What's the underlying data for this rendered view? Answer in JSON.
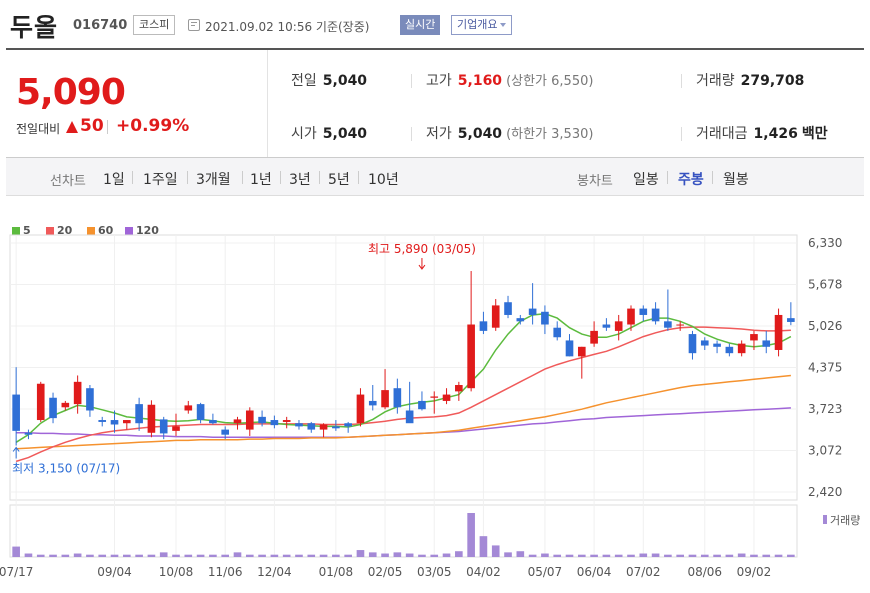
{
  "header": {
    "name": "두올",
    "code": "016740",
    "market": "코스피",
    "timestamp": "2021.09.02 10:56 기준(장중)",
    "realtime_label": "실시간",
    "company_label": "기업개요"
  },
  "quote": {
    "price": "5,090",
    "change_label": "전일대비",
    "change": "50",
    "change_pct": "+0.99%",
    "prev_close_label": "전일",
    "prev_close": "5,040",
    "high_label": "고가",
    "high": "5,160",
    "upper_limit": "(상한가 6,550)",
    "volume_label": "거래량",
    "volume": "279,708",
    "open_label": "시가",
    "open": "5,040",
    "low_label": "저가",
    "low": "5,040",
    "lower_limit": "(하한가 3,530)",
    "amount_label": "거래대금",
    "amount": "1,426",
    "amount_unit": "백만"
  },
  "tabs": {
    "line_label": "선차트",
    "line_items": [
      "1일",
      "1주일",
      "3개월",
      "1년",
      "3년",
      "5년",
      "10년"
    ],
    "candle_label": "봉차트",
    "candle_items": [
      "일봉",
      "주봉",
      "월봉"
    ],
    "candle_selected": 1
  },
  "colors": {
    "up": "#e01b1b",
    "down": "#2f6fd6",
    "ma5": "#5cbb3e",
    "ma20": "#f05a5a",
    "ma60": "#f5922e",
    "ma120": "#a065d8",
    "volume": "#a489d6"
  },
  "chart_data": {
    "type": "candlestick",
    "legend": [
      "5",
      "20",
      "60",
      "120"
    ],
    "y_ticks": [
      "6,330",
      "5,678",
      "5,026",
      "4,375",
      "3,723",
      "3,072",
      "2,420"
    ],
    "y_values": [
      6330,
      5678,
      5026,
      4375,
      3723,
      3072,
      2420
    ],
    "ylim": [
      2420,
      6330
    ],
    "x_ticks": [
      "07/17",
      "09/04",
      "10/08",
      "11/06",
      "12/04",
      "01/08",
      "02/05",
      "03/05",
      "04/02",
      "05/07",
      "06/04",
      "07/02",
      "08/06",
      "09/02"
    ],
    "x_tick_index": [
      0,
      8,
      13,
      17,
      21,
      26,
      30,
      34,
      38,
      43,
      47,
      51,
      56,
      60
    ],
    "max_annotation": "최고 5,890 (03/05)",
    "max_index": 33,
    "max_value": 5890,
    "min_annotation": "최저 3,150 (07/17)",
    "min_index": 0,
    "min_value": 3150,
    "volume_label": "거래량",
    "candles": [
      {
        "o": 3950,
        "h": 4380,
        "l": 3150,
        "c": 3380
      },
      {
        "o": 3350,
        "h": 3400,
        "l": 3250,
        "c": 3320
      },
      {
        "o": 3550,
        "h": 4150,
        "l": 3520,
        "c": 4120
      },
      {
        "o": 3900,
        "h": 3980,
        "l": 3500,
        "c": 3580
      },
      {
        "o": 3750,
        "h": 3850,
        "l": 3700,
        "c": 3820
      },
      {
        "o": 3800,
        "h": 4250,
        "l": 3650,
        "c": 4150
      },
      {
        "o": 4050,
        "h": 4100,
        "l": 3600,
        "c": 3700
      },
      {
        "o": 3550,
        "h": 3600,
        "l": 3450,
        "c": 3520
      },
      {
        "o": 3550,
        "h": 3700,
        "l": 3350,
        "c": 3480
      },
      {
        "o": 3500,
        "h": 3550,
        "l": 3400,
        "c": 3550
      },
      {
        "o": 3800,
        "h": 3900,
        "l": 3380,
        "c": 3500
      },
      {
        "o": 3350,
        "h": 3860,
        "l": 3280,
        "c": 3790
      },
      {
        "o": 3560,
        "h": 3600,
        "l": 3250,
        "c": 3340
      },
      {
        "o": 3380,
        "h": 3650,
        "l": 3300,
        "c": 3450
      },
      {
        "o": 3700,
        "h": 3850,
        "l": 3650,
        "c": 3780
      },
      {
        "o": 3800,
        "h": 3820,
        "l": 3500,
        "c": 3550
      },
      {
        "o": 3550,
        "h": 3650,
        "l": 3480,
        "c": 3500
      },
      {
        "o": 3400,
        "h": 3450,
        "l": 3250,
        "c": 3320
      },
      {
        "o": 3500,
        "h": 3600,
        "l": 3400,
        "c": 3560
      },
      {
        "o": 3400,
        "h": 3750,
        "l": 3300,
        "c": 3700
      },
      {
        "o": 3600,
        "h": 3700,
        "l": 3450,
        "c": 3500
      },
      {
        "o": 3550,
        "h": 3620,
        "l": 3420,
        "c": 3470
      },
      {
        "o": 3520,
        "h": 3600,
        "l": 3420,
        "c": 3550
      },
      {
        "o": 3500,
        "h": 3550,
        "l": 3400,
        "c": 3450
      },
      {
        "o": 3500,
        "h": 3520,
        "l": 3350,
        "c": 3400
      },
      {
        "o": 3400,
        "h": 3500,
        "l": 3280,
        "c": 3480
      },
      {
        "o": 3450,
        "h": 3550,
        "l": 3380,
        "c": 3420
      },
      {
        "o": 3500,
        "h": 3520,
        "l": 3350,
        "c": 3450
      },
      {
        "o": 3500,
        "h": 4050,
        "l": 3450,
        "c": 3950
      },
      {
        "o": 3850,
        "h": 4100,
        "l": 3700,
        "c": 3780
      },
      {
        "o": 3750,
        "h": 4350,
        "l": 3720,
        "c": 4020
      },
      {
        "o": 4050,
        "h": 4200,
        "l": 3650,
        "c": 3750
      },
      {
        "o": 3700,
        "h": 4150,
        "l": 3550,
        "c": 3500
      },
      {
        "o": 3850,
        "h": 4000,
        "l": 3700,
        "c": 3720
      },
      {
        "o": 3900,
        "h": 4000,
        "l": 3650,
        "c": 3920
      },
      {
        "o": 3850,
        "h": 4050,
        "l": 3800,
        "c": 3950
      },
      {
        "o": 4000,
        "h": 4150,
        "l": 3850,
        "c": 4100
      },
      {
        "o": 4050,
        "h": 5890,
        "l": 4000,
        "c": 5050
      },
      {
        "o": 5100,
        "h": 5250,
        "l": 4900,
        "c": 4950
      },
      {
        "o": 5000,
        "h": 5450,
        "l": 4950,
        "c": 5350
      },
      {
        "o": 5400,
        "h": 5500,
        "l": 5150,
        "c": 5200
      },
      {
        "o": 5150,
        "h": 5200,
        "l": 5050,
        "c": 5100
      },
      {
        "o": 5300,
        "h": 5700,
        "l": 5050,
        "c": 5200
      },
      {
        "o": 5250,
        "h": 5350,
        "l": 4900,
        "c": 5050
      },
      {
        "o": 5000,
        "h": 5100,
        "l": 4800,
        "c": 4850
      },
      {
        "o": 4800,
        "h": 4900,
        "l": 4550,
        "c": 4550
      },
      {
        "o": 4550,
        "h": 4700,
        "l": 4200,
        "c": 4700
      },
      {
        "o": 4750,
        "h": 5100,
        "l": 4700,
        "c": 4950
      },
      {
        "o": 5050,
        "h": 5150,
        "l": 4950,
        "c": 5000
      },
      {
        "o": 4950,
        "h": 5200,
        "l": 4800,
        "c": 5100
      },
      {
        "o": 5050,
        "h": 5350,
        "l": 4950,
        "c": 5300
      },
      {
        "o": 5300,
        "h": 5350,
        "l": 5100,
        "c": 5200
      },
      {
        "o": 5300,
        "h": 5400,
        "l": 5050,
        "c": 5100
      },
      {
        "o": 5100,
        "h": 5600,
        "l": 4950,
        "c": 5000
      },
      {
        "o": 5050,
        "h": 5100,
        "l": 4950,
        "c": 5050
      },
      {
        "o": 4900,
        "h": 4950,
        "l": 4500,
        "c": 4600
      },
      {
        "o": 4800,
        "h": 4850,
        "l": 4650,
        "c": 4720
      },
      {
        "o": 4750,
        "h": 4800,
        "l": 4600,
        "c": 4700
      },
      {
        "o": 4700,
        "h": 4750,
        "l": 4550,
        "c": 4600
      },
      {
        "o": 4600,
        "h": 4800,
        "l": 4550,
        "c": 4750
      },
      {
        "o": 4800,
        "h": 4950,
        "l": 4650,
        "c": 4900
      },
      {
        "o": 4800,
        "h": 4950,
        "l": 4600,
        "c": 4700
      },
      {
        "o": 4650,
        "h": 5300,
        "l": 4550,
        "c": 5200
      },
      {
        "o": 5150,
        "h": 5400,
        "l": 5040,
        "c": 5090
      }
    ],
    "volume": [
      9,
      3,
      2,
      2,
      2,
      3,
      2,
      2,
      2,
      2,
      2,
      2,
      4,
      2,
      2,
      2,
      2,
      2,
      4,
      2,
      2,
      2,
      2,
      2,
      2,
      2,
      2,
      2,
      6,
      4,
      3,
      4,
      3,
      2,
      2,
      3,
      5,
      38,
      18,
      10,
      4,
      5,
      2,
      3,
      2,
      2,
      2,
      2,
      2,
      2,
      2,
      3,
      3,
      2,
      2,
      2,
      2,
      2,
      2,
      3,
      2,
      2,
      2,
      2
    ],
    "ma5": [
      3200,
      3320,
      3500,
      3620,
      3700,
      3780,
      3760,
      3710,
      3660,
      3600,
      3580,
      3560,
      3540,
      3530,
      3540,
      3560,
      3540,
      3510,
      3500,
      3510,
      3520,
      3500,
      3480,
      3470,
      3460,
      3450,
      3450,
      3440,
      3480,
      3560,
      3680,
      3760,
      3800,
      3830,
      3850,
      3900,
      3950,
      4150,
      4350,
      4650,
      4900,
      5100,
      5200,
      5220,
      5150,
      5000,
      4900,
      4850,
      4850,
      4900,
      5000,
      5100,
      5150,
      5150,
      5100,
      5020,
      4900,
      4820,
      4760,
      4720,
      4700,
      4720,
      4760,
      4860
    ],
    "ma20": [
      2900,
      2960,
      3050,
      3130,
      3200,
      3260,
      3310,
      3350,
      3380,
      3400,
      3420,
      3440,
      3450,
      3460,
      3470,
      3480,
      3480,
      3480,
      3480,
      3490,
      3490,
      3490,
      3490,
      3490,
      3490,
      3480,
      3480,
      3480,
      3490,
      3510,
      3530,
      3560,
      3580,
      3590,
      3600,
      3620,
      3660,
      3750,
      3850,
      3950,
      4050,
      4150,
      4250,
      4350,
      4420,
      4480,
      4530,
      4580,
      4630,
      4700,
      4780,
      4860,
      4920,
      4970,
      5000,
      5010,
      5010,
      5000,
      4990,
      4980,
      4960,
      4950,
      4950,
      4960
    ],
    "ma60": [
      3100,
      3110,
      3120,
      3130,
      3140,
      3150,
      3160,
      3170,
      3180,
      3190,
      3200,
      3210,
      3220,
      3230,
      3230,
      3240,
      3240,
      3240,
      3240,
      3250,
      3250,
      3260,
      3260,
      3260,
      3270,
      3270,
      3270,
      3280,
      3290,
      3300,
      3310,
      3320,
      3330,
      3340,
      3350,
      3370,
      3390,
      3420,
      3450,
      3480,
      3510,
      3540,
      3570,
      3600,
      3640,
      3680,
      3720,
      3770,
      3820,
      3860,
      3900,
      3940,
      3980,
      4020,
      4060,
      4090,
      4110,
      4130,
      4150,
      4170,
      4190,
      4210,
      4230,
      4250
    ],
    "ma120": [
      3350,
      3350,
      3340,
      3340,
      3330,
      3330,
      3320,
      3320,
      3310,
      3310,
      3300,
      3300,
      3300,
      3290,
      3290,
      3290,
      3280,
      3280,
      3280,
      3280,
      3280,
      3280,
      3280,
      3280,
      3280,
      3280,
      3280,
      3280,
      3290,
      3300,
      3310,
      3320,
      3330,
      3340,
      3350,
      3360,
      3370,
      3390,
      3410,
      3430,
      3450,
      3470,
      3490,
      3500,
      3520,
      3540,
      3560,
      3570,
      3590,
      3600,
      3610,
      3620,
      3630,
      3640,
      3650,
      3660,
      3670,
      3680,
      3690,
      3700,
      3710,
      3720,
      3730,
      3740
    ]
  }
}
